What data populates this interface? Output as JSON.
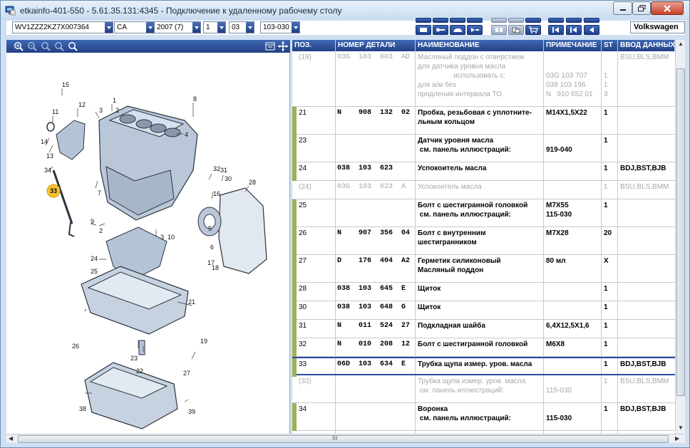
{
  "window": {
    "title": "etkainfo-401-550 - 5.61.35.131:4345 - Подключение к удаленному рабочему столу"
  },
  "toolbar": {
    "vin": "WV1ZZZ2KZ7X007364",
    "market": "CA",
    "model_year": "2007 (7)",
    "main_group": "1",
    "sub_group": "03",
    "illustration": "103-030",
    "brand": "Volkswagen"
  },
  "table": {
    "headers": {
      "pos": "ПОЗ.",
      "part_number": "НОМЕР ДЕТАЛИ",
      "name": "НАИМЕНОВАНИЕ",
      "note": "ПРИМЕЧАНИЕ",
      "st": "ST",
      "input": "ВВОД ДАННЫХ"
    },
    "rows": [
      {
        "pos": "(19)",
        "num": "03G  103  603  AD",
        "name": "Масляный поддон с отверстием\nдля датчика уровня масла\n                  использовать с:\nдля а/м без\nпродления интервала ТО",
        "note": "\n\n03G 103 707\n038 103 196\nN   910 652 01",
        "st": "\n\n1\n1\n3",
        "input": "BSU,BLS,BMM",
        "gray": true,
        "bar": false
      },
      {
        "pos": "21",
        "num": "N    908  132  02",
        "name": "Пробка, резьбовая с уплотните-\nльным кольцом",
        "note": "M14X1,5X22",
        "st": "1",
        "input": "",
        "gray": false,
        "bar": true
      },
      {
        "pos": "23",
        "num": "",
        "name": "Датчик уровня масла\n см. панель иллюстраций:",
        "note": "\n919-040",
        "st": "1",
        "input": "",
        "gray": false,
        "bar": true
      },
      {
        "pos": "24",
        "num": "038  103  623",
        "name": "Успокоитель масла",
        "note": "",
        "st": "1",
        "input": "BDJ,BST,BJB",
        "gray": false,
        "bar": true
      },
      {
        "pos": "(24)",
        "num": "03G  103  623  A",
        "name": "Успокоитель масла",
        "note": "",
        "st": "1",
        "input": "BSU,BLS,BMM",
        "gray": true,
        "bar": false
      },
      {
        "pos": "25",
        "num": "",
        "name": "Болт с шестигранной головкой\n см. панель иллюстраций:",
        "note": "M7X55\n115-030",
        "st": "1",
        "input": "",
        "gray": false,
        "bar": true
      },
      {
        "pos": "26",
        "num": "N    907  356  04",
        "name": "Болт с внутренним\nшестигранником",
        "note": "M7X28",
        "st": "20",
        "input": "",
        "gray": false,
        "bar": true
      },
      {
        "pos": "27",
        "num": "D    176  404  A2",
        "name": "Герметик силиконовый\nМасляный поддон",
        "note": "80 мл",
        "st": "X",
        "input": "",
        "gray": false,
        "bar": true
      },
      {
        "pos": "28",
        "num": "038  103  645  E",
        "name": "Щиток",
        "note": "",
        "st": "1",
        "input": "",
        "gray": false,
        "bar": true
      },
      {
        "pos": "30",
        "num": "038  103  648  G",
        "name": "Щиток",
        "note": "",
        "st": "1",
        "input": "",
        "gray": false,
        "bar": true
      },
      {
        "pos": "31",
        "num": "N    011  524  27",
        "name": "Подкладная шайба",
        "note": "6,4X12,5X1,6",
        "st": "1",
        "input": "",
        "gray": false,
        "bar": true
      },
      {
        "pos": "32",
        "num": "N    010  208  12",
        "name": "Болт с шестигранной головкой",
        "note": "M6X8",
        "st": "1",
        "input": "",
        "gray": false,
        "bar": true
      },
      {
        "pos": "33",
        "num": "06D  103  634  E",
        "name": "Трубка щупа измер. уров. масла",
        "note": "",
        "st": "1",
        "input": "BDJ,BST,BJB",
        "gray": false,
        "bar": true,
        "selected": true
      },
      {
        "pos": "(33)",
        "num": "",
        "name": "Трубка щупа измер. уров. масла\n см. панель иллюстраций:",
        "note": "\n115-030",
        "st": "1",
        "input": "BSU,BLS,BMM",
        "gray": true,
        "bar": false
      },
      {
        "pos": "34",
        "num": "",
        "name": "Воронка\n см. панель иллюстраций:",
        "note": "\n115-030",
        "st": "1",
        "input": "BDJ,BST,BJB",
        "gray": false,
        "bar": true
      }
    ]
  },
  "diagram": {
    "highlight_label": "33",
    "labels": [
      "15",
      "12",
      "11",
      "14",
      "13",
      "34",
      "1",
      "2",
      "3",
      "4",
      "8",
      "5",
      "6",
      "7",
      "9",
      "32",
      "31",
      "30",
      "16",
      "28",
      "3",
      "10",
      "2",
      "24",
      "25",
      "17",
      "18",
      "21",
      "19",
      "26",
      "23",
      "22",
      "27",
      "38",
      "39"
    ]
  },
  "scroll": {
    "h_indicator": "III"
  }
}
